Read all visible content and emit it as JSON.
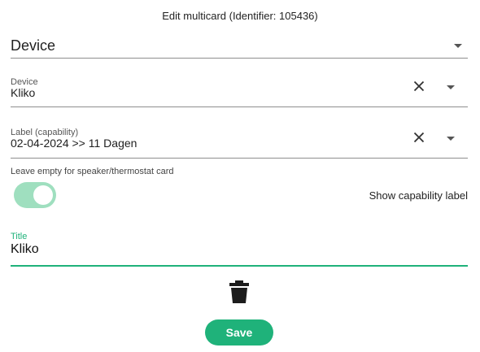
{
  "dialog": {
    "title": "Edit multicard (Identifier: 105436)"
  },
  "type_select": {
    "value": "Device",
    "icon": "chevron-down-icon"
  },
  "device_select": {
    "label": "Device",
    "value": "Kliko",
    "clear_icon": "close-icon",
    "icon": "chevron-down-icon"
  },
  "capability_select": {
    "label": "Label (capability)",
    "value": "02-04-2024 >> 11 Dagen",
    "clear_icon": "close-icon",
    "icon": "chevron-down-icon"
  },
  "hint": {
    "text": "Leave empty for speaker/thermostat card"
  },
  "show_capability_toggle": {
    "label": "Show capability label",
    "checked": true
  },
  "title_field": {
    "label": "Title",
    "value": "Kliko"
  },
  "actions": {
    "delete_icon": "trash-icon",
    "save_label": "Save"
  },
  "colors": {
    "accent": "#1fb27a",
    "toggle_track": "#9fdfbf",
    "divider": "#8f8f8f"
  }
}
